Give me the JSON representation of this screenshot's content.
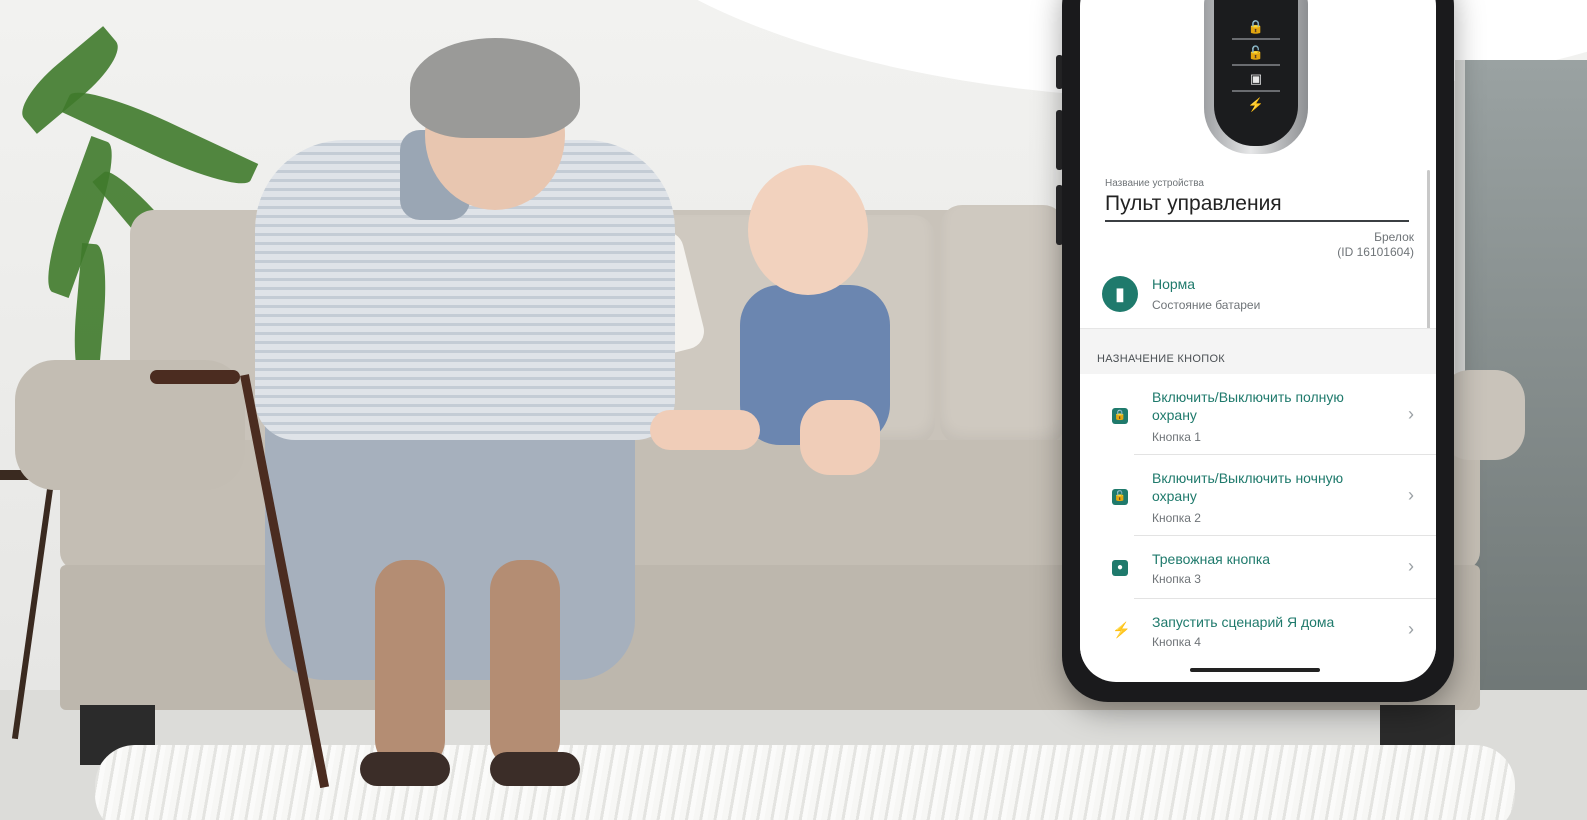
{
  "device": {
    "name_label": "Название устройства",
    "name_value": "Пульт управления",
    "type": "Брелок",
    "id": "(ID 16101604)"
  },
  "battery": {
    "status": "Норма",
    "label": "Состояние батареи",
    "icon": "battery-icon"
  },
  "section_title": "НАЗНАЧЕНИЕ КНОПОК",
  "buttons": [
    {
      "title": "Включить/Выключить полную охрану",
      "sub": "Кнопка 1",
      "icon": "lock-icon"
    },
    {
      "title": "Включить/Выключить ночную охрану",
      "sub": "Кнопка 2",
      "icon": "unlock-icon"
    },
    {
      "title": "Тревожная кнопка",
      "sub": "Кнопка 3",
      "icon": "alarm-icon"
    },
    {
      "title": "Запустить сценарий Я дома",
      "sub": "Кнопка 4",
      "icon": "lightning-icon"
    }
  ],
  "colors": {
    "accent": "#1f7a6c"
  }
}
